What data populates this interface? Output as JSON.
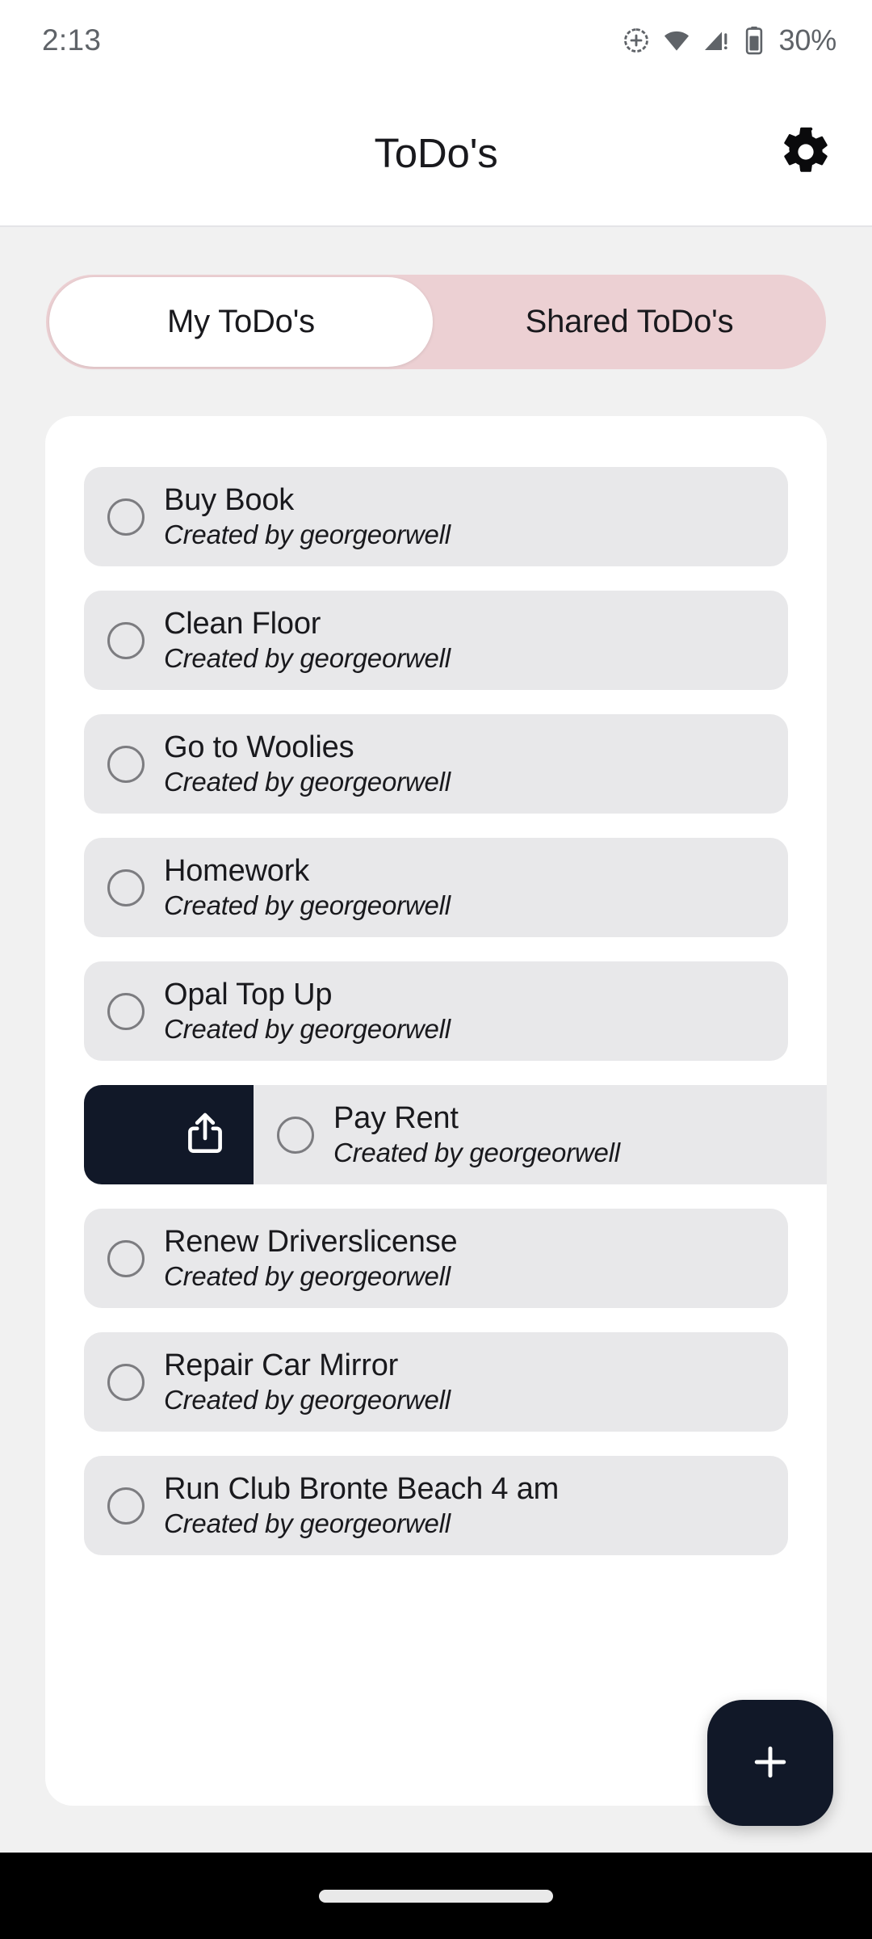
{
  "status_bar": {
    "clock": "2:13",
    "battery_percent": "30%",
    "icons": [
      "location-add-icon",
      "wifi-icon",
      "cellular-signal-warning-icon",
      "battery-icon"
    ]
  },
  "app_bar": {
    "title": "ToDo's",
    "settings_icon": "gear-icon"
  },
  "tabs": {
    "active_index": 0,
    "items": [
      {
        "label": "My ToDo's"
      },
      {
        "label": "Shared ToDo's"
      }
    ]
  },
  "todo_list": {
    "items": [
      {
        "title": "Buy Book",
        "subtitle": "Created by georgeorwell",
        "checked": false,
        "swiped": false
      },
      {
        "title": "Clean Floor",
        "subtitle": "Created by georgeorwell",
        "checked": false,
        "swiped": false
      },
      {
        "title": "Go to Woolies",
        "subtitle": "Created by georgeorwell",
        "checked": false,
        "swiped": false
      },
      {
        "title": "Homework",
        "subtitle": "Created by georgeorwell",
        "checked": false,
        "swiped": false
      },
      {
        "title": "Opal Top Up",
        "subtitle": "Created by georgeorwell",
        "checked": false,
        "swiped": false
      },
      {
        "title": "Pay Rent",
        "subtitle": "Created by georgeorwell",
        "checked": false,
        "swiped": true,
        "swipe_action": "share-icon"
      },
      {
        "title": "Renew Driverslicense",
        "subtitle": "Created by georgeorwell",
        "checked": false,
        "swiped": false
      },
      {
        "title": "Repair Car Mirror",
        "subtitle": "Created by georgeorwell",
        "checked": false,
        "swiped": false
      },
      {
        "title": "Run Club Bronte Beach 4 am",
        "subtitle": "Created by georgeorwell",
        "checked": false,
        "swiped": false
      }
    ]
  },
  "fab": {
    "icon": "plus-icon",
    "label": "+"
  },
  "nav_bar": {
    "gesture_pill": "home-indicator"
  },
  "colors": {
    "accent_pink": "#ecd0d3",
    "dark_navy": "#111828",
    "row_gray": "#e8e8ea",
    "page_bg": "#f1f1f1",
    "card_white": "#ffffff",
    "text_primary": "#19191d",
    "status_text": "#5f6368"
  }
}
